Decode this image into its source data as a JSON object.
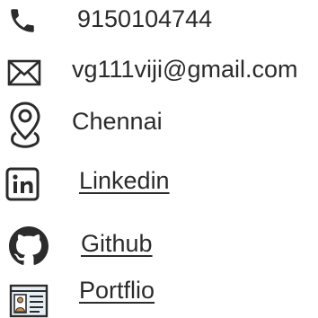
{
  "contacts": {
    "phone": {
      "icon": "phone-icon",
      "text": "9150104744"
    },
    "email": {
      "icon": "mail-icon",
      "text": "vg111viji@gmail.com"
    },
    "location": {
      "icon": "location-pin-icon",
      "text": "Chennai"
    },
    "linkedin": {
      "icon": "linkedin-icon",
      "text": "Linkedin"
    },
    "github": {
      "icon": "github-icon",
      "text": "Github"
    },
    "portfolio": {
      "icon": "portfolio-card-icon",
      "text": "Portflio"
    }
  },
  "colors": {
    "text": "#2b2b2b",
    "icon": "#2b2b2b",
    "portfolio_card_bg": "#e6eef6",
    "portfolio_avatar": "#c9904f"
  }
}
